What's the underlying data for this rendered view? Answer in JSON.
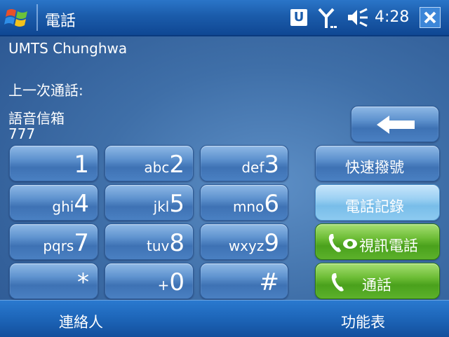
{
  "title_bar": {
    "title": "電話",
    "status_u": "U",
    "time": "4:28",
    "icons": [
      "windows-start-icon",
      "u-icon",
      "signal-icon",
      "volume-icon",
      "close-icon"
    ]
  },
  "info": {
    "operator": "UMTS Chunghwa",
    "last_call_label": "上一次通話:",
    "voicemail_label": "語音信箱",
    "voicemail_number": "777"
  },
  "keypad": {
    "keys": [
      {
        "letters": "",
        "digit": "1"
      },
      {
        "letters": "abc",
        "digit": "2"
      },
      {
        "letters": "def",
        "digit": "3"
      },
      {
        "letters": "ghi",
        "digit": "4"
      },
      {
        "letters": "jkl",
        "digit": "5"
      },
      {
        "letters": "mno",
        "digit": "6"
      },
      {
        "letters": "pqrs",
        "digit": "7"
      },
      {
        "letters": "tuv",
        "digit": "8"
      },
      {
        "letters": "wxyz",
        "digit": "9"
      },
      {
        "letters": "",
        "digit": "*"
      },
      {
        "letters": "+",
        "digit": "0"
      },
      {
        "letters": "",
        "digit": "#"
      }
    ]
  },
  "side_buttons": {
    "speed_dial": "快速撥號",
    "call_history": "電話記錄",
    "video_call": "視訊電話",
    "talk": "通話"
  },
  "soft_keys": {
    "left": "連絡人",
    "right": "功能表"
  },
  "colors": {
    "title_bar": "#1b5cab",
    "key_blue": "#5f93cf",
    "key_light": "#9bd0f3",
    "key_green": "#6dbd36"
  }
}
